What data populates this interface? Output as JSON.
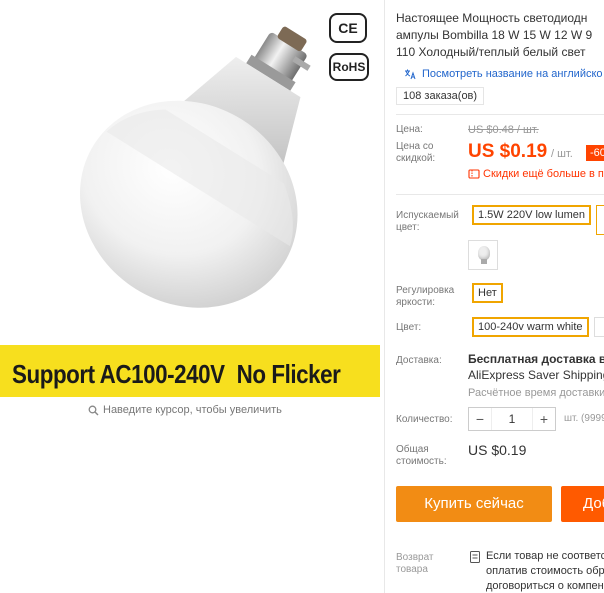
{
  "image": {
    "cert_ce": "CE",
    "cert_rohs": "RoHS",
    "banner_part1": "Support AC100-240V",
    "banner_part2": "No Flicker",
    "zoom_hint": "Наведите курсор, чтобы увеличить"
  },
  "product": {
    "title_lines": [
      "Настоящее Мощность светодиодн",
      "ампулы Bombilla 18 W 15 W 12 W 9",
      "110 Холодный/теплый белый свет"
    ],
    "english_link": "Посмотреть название на английско",
    "orders": "108 заказа(ов)"
  },
  "price": {
    "label": "Цена:",
    "old": "US $0.48 / шт.",
    "discount_label": "Цена со скидкой:",
    "new": "US $0.19",
    "per_piece": "/ шт.",
    "discount_badge": "-60",
    "promo": "Скидки ещё больше в п"
  },
  "options": {
    "emit_color_label": "Испускаемый цвет:",
    "emit_color_value": "1.5W 220V low lumen",
    "dimmable_label": "Регулировка яркости:",
    "dimmable_value": "Нет",
    "color_label": "Цвет:",
    "color_value": "100-240v warm white"
  },
  "shipping": {
    "label": "Доставка:",
    "title": "Бесплатная доставка в Ru",
    "method": "AliExpress Saver Shipping",
    "time": "Расчётное время доставки"
  },
  "quantity": {
    "label": "Количество:",
    "minus": "−",
    "value": "1",
    "plus": "+",
    "note": "шт. (9999"
  },
  "total": {
    "label": "Общая стоимость:",
    "value": "US $0.19"
  },
  "actions": {
    "buy_now": "Купить сейчас",
    "add_to_cart": "Доб"
  },
  "returns": {
    "label": "Возврат товара",
    "lines": [
      "Если товар не соответст",
      "оплатив стоимость обр",
      "договориться о компен"
    ]
  },
  "colors": {
    "price_accent": "#ff4400",
    "option_border": "#f0a500",
    "buy_button": "#f28c14",
    "cart_button": "#ff5a00",
    "banner": "#f7df1e",
    "link": "#2266cc"
  }
}
